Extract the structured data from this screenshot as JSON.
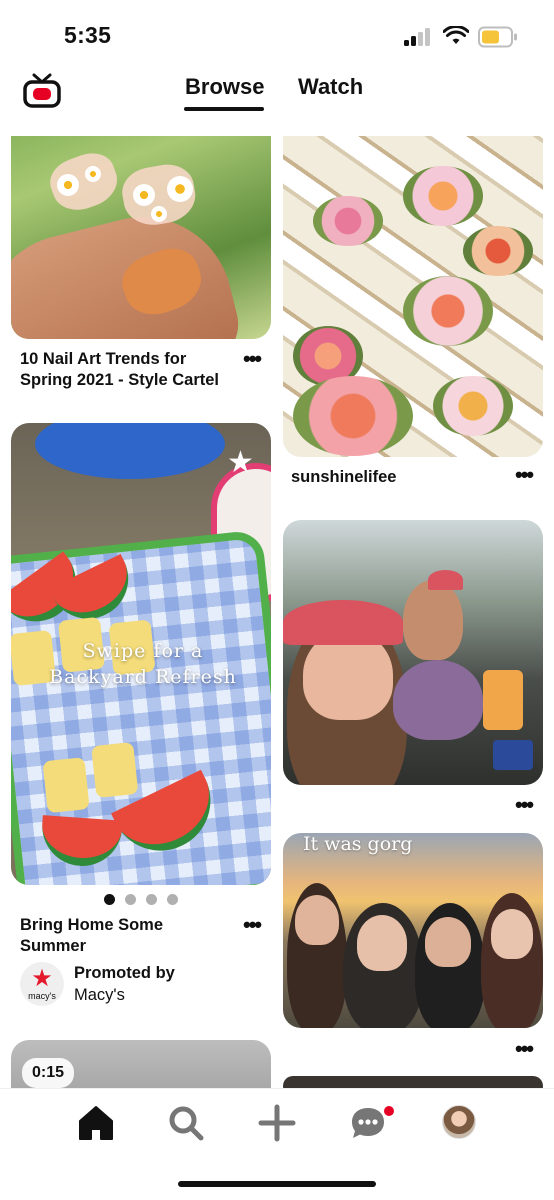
{
  "status_bar": {
    "time": "5:35"
  },
  "header": {
    "tabs": [
      {
        "label": "Browse",
        "active": true
      },
      {
        "label": "Watch",
        "active": false
      }
    ]
  },
  "pins": {
    "nails": {
      "title_line1": "10 Nail Art Trends for",
      "title_line2": "Spring 2021 - Style Cartel"
    },
    "flowers": {
      "title": "sunshinelifee"
    },
    "fruit": {
      "overlay_line1": "Swipe for a",
      "overlay_line2": "Backyard Refresh",
      "title_line1": "Bring Home Some",
      "title_line2": "Summer",
      "carousel": {
        "count": 4,
        "active_index": 0
      },
      "promoted_label": "Promoted by",
      "advertiser": "Macy's",
      "advertiser_wordmark": "macy's"
    },
    "sunset": {
      "overlay_text": "It was gorg"
    },
    "video": {
      "duration": "0:15"
    }
  },
  "more_icon": "•••",
  "bottom_nav": {
    "items": [
      "home-icon",
      "search-icon",
      "plus-icon",
      "chat-icon",
      "profile-avatar"
    ],
    "active": "home-icon",
    "notification_color": "#e60023"
  },
  "colors": {
    "brand_red": "#e60023",
    "text": "#111111"
  }
}
